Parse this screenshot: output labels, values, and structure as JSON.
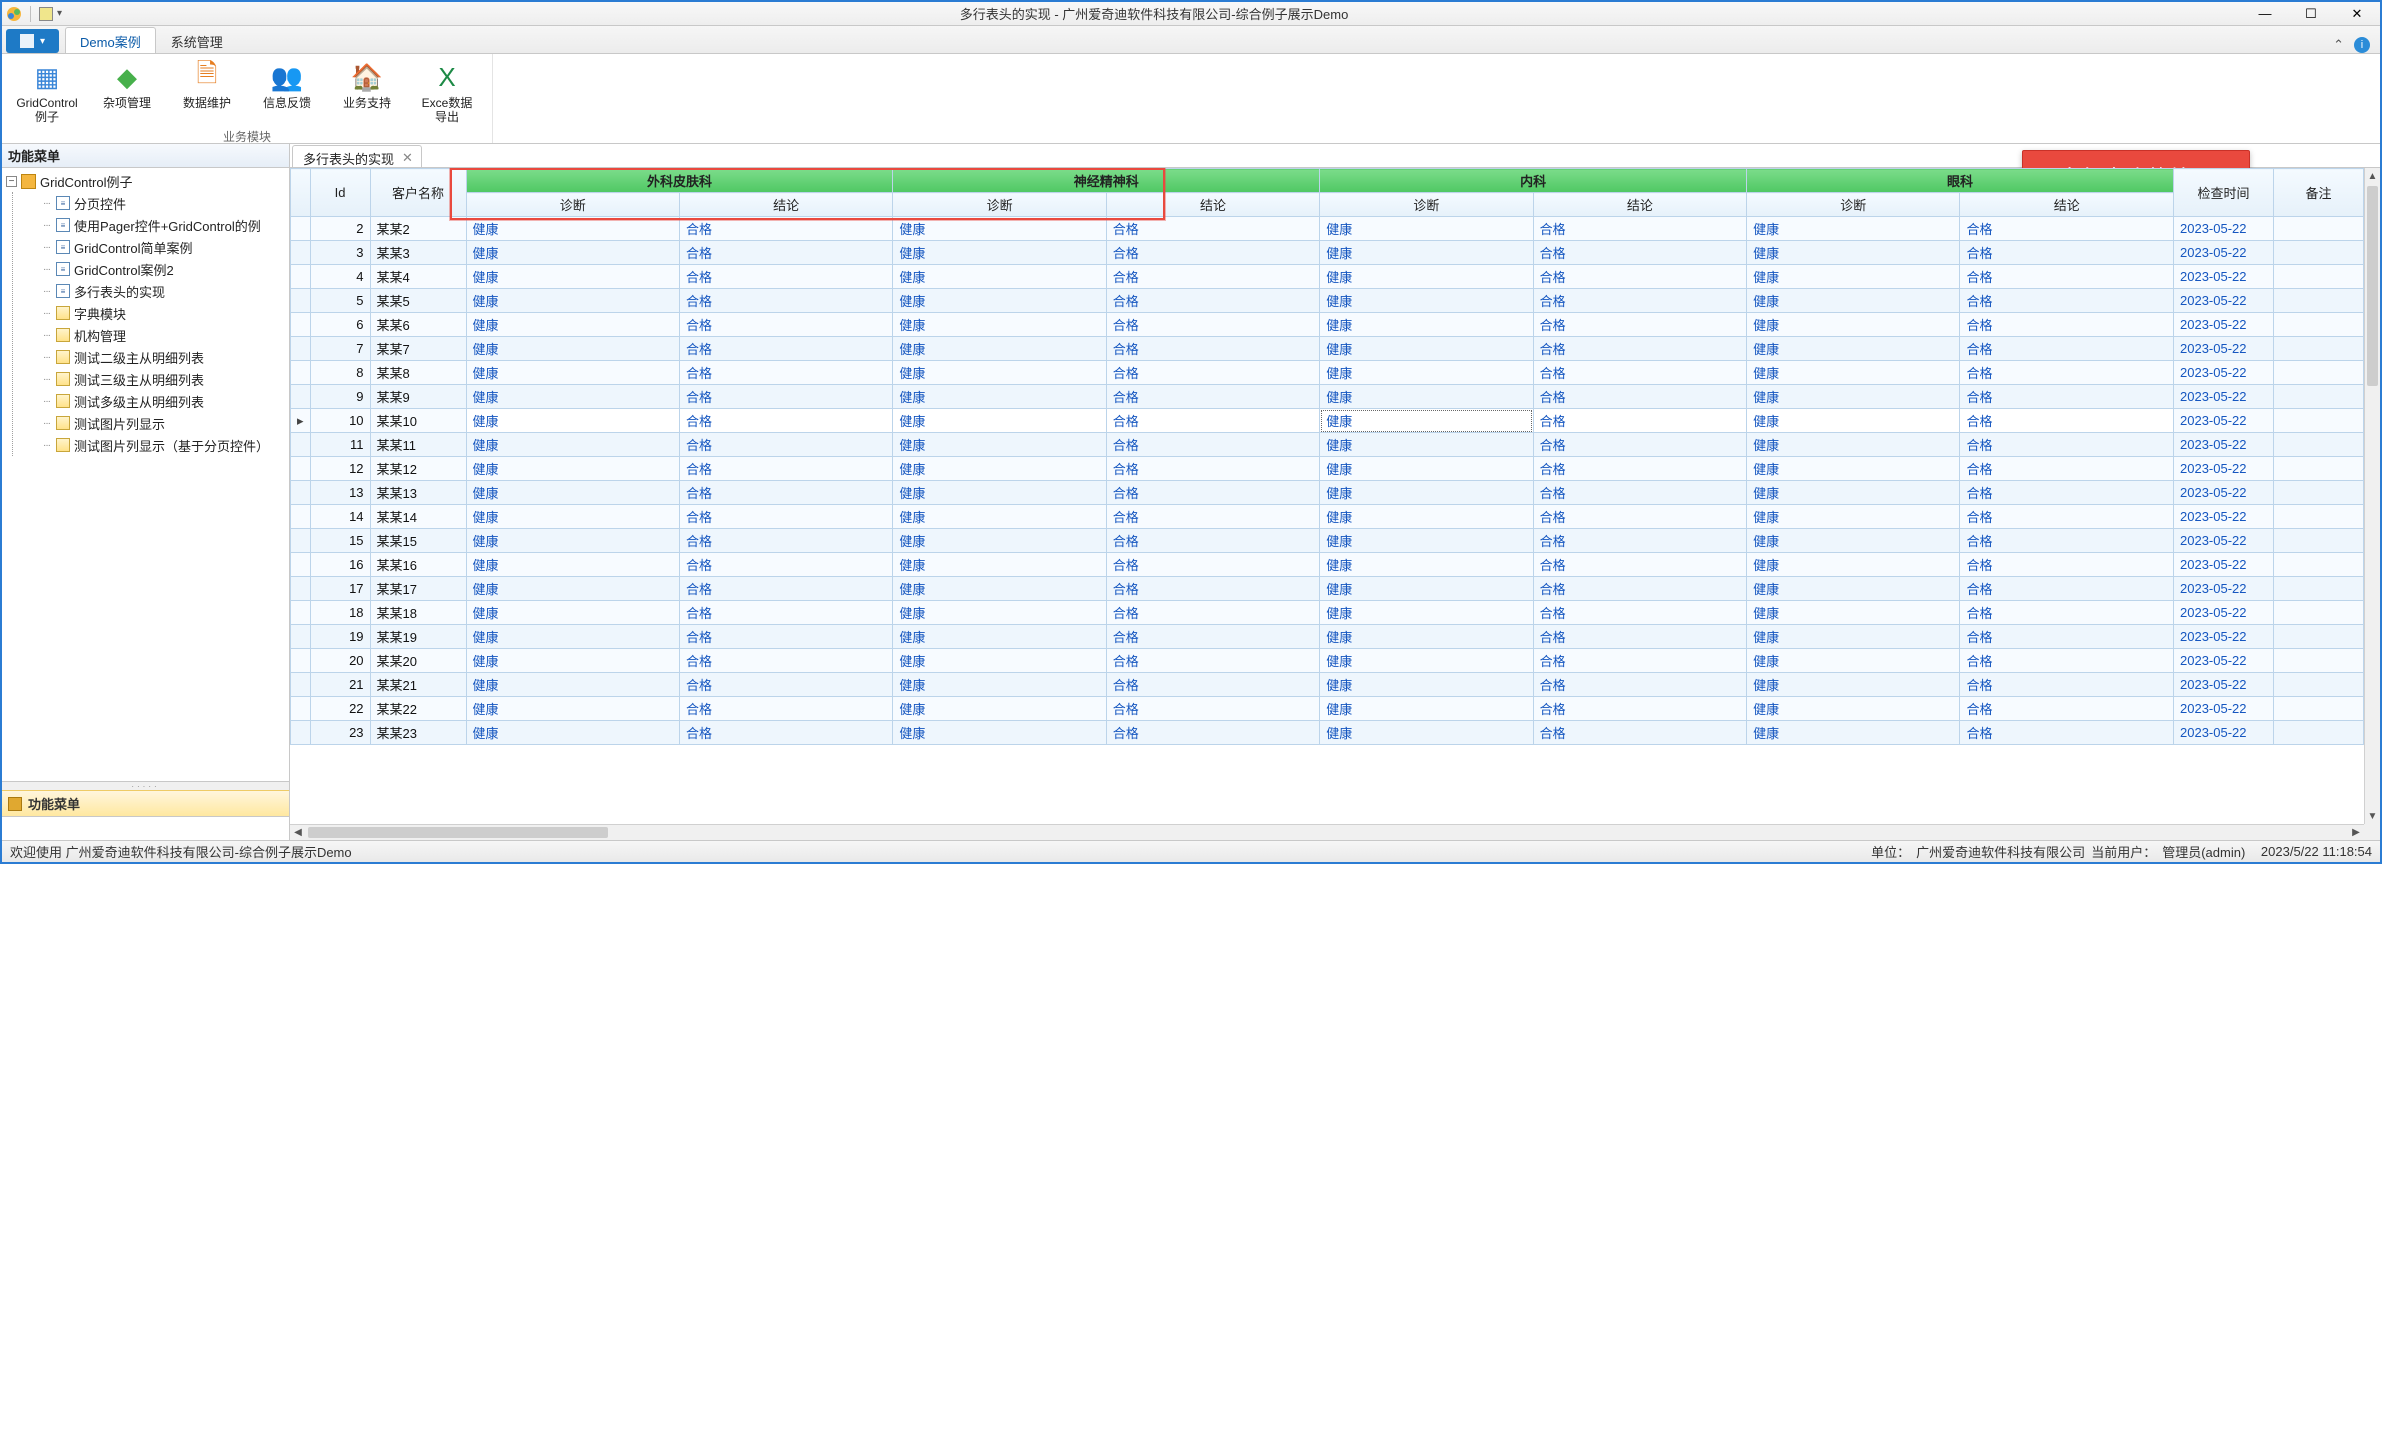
{
  "window": {
    "title": "多行表头的实现 - 广州爱奇迪软件科技有限公司-综合例子展示Demo"
  },
  "ribbon": {
    "tabs": [
      {
        "label": "Demo案例",
        "active": true
      },
      {
        "label": "系统管理",
        "active": false
      }
    ],
    "group_name": "业务模块",
    "items": [
      {
        "label": "GridControl例子",
        "icon": "grid-icon"
      },
      {
        "label": "杂项管理",
        "icon": "misc-icon"
      },
      {
        "label": "数据维护",
        "icon": "data-icon"
      },
      {
        "label": "信息反馈",
        "icon": "feedback-icon"
      },
      {
        "label": "业务支持",
        "icon": "support-icon"
      },
      {
        "label": "Exce数据导出",
        "icon": "excel-icon"
      }
    ]
  },
  "callout": "多行表头的处理",
  "nav": {
    "header": "功能菜单",
    "root": "GridControl例子",
    "items": [
      "分页控件",
      "使用Pager控件+GridControl的例",
      "GridControl简单案例",
      "GridControl案例2",
      "多行表头的实现",
      "字典模块",
      "机构管理",
      "测试二级主从明细列表",
      "测试三级主从明细列表",
      "测试多级主从明细列表",
      "测试图片列显示",
      "测试图片列显示（基于分页控件）"
    ],
    "bottom_btn": "功能菜单"
  },
  "doc_tab": {
    "label": "多行表头的实现"
  },
  "grid": {
    "headers": {
      "id": "Id",
      "cust": "客户名称",
      "groups": [
        "外科皮肤科",
        "神经精神科",
        "内科",
        "眼科"
      ],
      "sub": {
        "diag": "诊断",
        "concl": "结论"
      },
      "time": "检查时间",
      "note": "备注"
    },
    "val": {
      "diag": "健康",
      "concl": "合格"
    },
    "date": "2023-05-22",
    "rows": [
      {
        "id": 2,
        "name": "某某2"
      },
      {
        "id": 3,
        "name": "某某3"
      },
      {
        "id": 4,
        "name": "某某4"
      },
      {
        "id": 5,
        "name": "某某5"
      },
      {
        "id": 6,
        "name": "某某6"
      },
      {
        "id": 7,
        "name": "某某7"
      },
      {
        "id": 8,
        "name": "某某8"
      },
      {
        "id": 9,
        "name": "某某9"
      },
      {
        "id": 10,
        "name": "某某10"
      },
      {
        "id": 11,
        "name": "某某11"
      },
      {
        "id": 12,
        "name": "某某12"
      },
      {
        "id": 13,
        "name": "某某13"
      },
      {
        "id": 14,
        "name": "某某14"
      },
      {
        "id": 15,
        "name": "某某15"
      },
      {
        "id": 16,
        "name": "某某16"
      },
      {
        "id": 17,
        "name": "某某17"
      },
      {
        "id": 18,
        "name": "某某18"
      },
      {
        "id": 19,
        "name": "某某19"
      },
      {
        "id": 20,
        "name": "某某20"
      },
      {
        "id": 21,
        "name": "某某21"
      },
      {
        "id": 22,
        "name": "某某22"
      },
      {
        "id": 23,
        "name": "某某23"
      }
    ],
    "current_row_id": 10
  },
  "status": {
    "welcome": "欢迎使用 广州爱奇迪软件科技有限公司-综合例子展示Demo",
    "unit_label": "单位：",
    "unit_value": "广州爱奇迪软件科技有限公司",
    "user_label": "当前用户：",
    "user_value": "管理员(admin)",
    "time": "2023/5/22 11:18:54"
  }
}
